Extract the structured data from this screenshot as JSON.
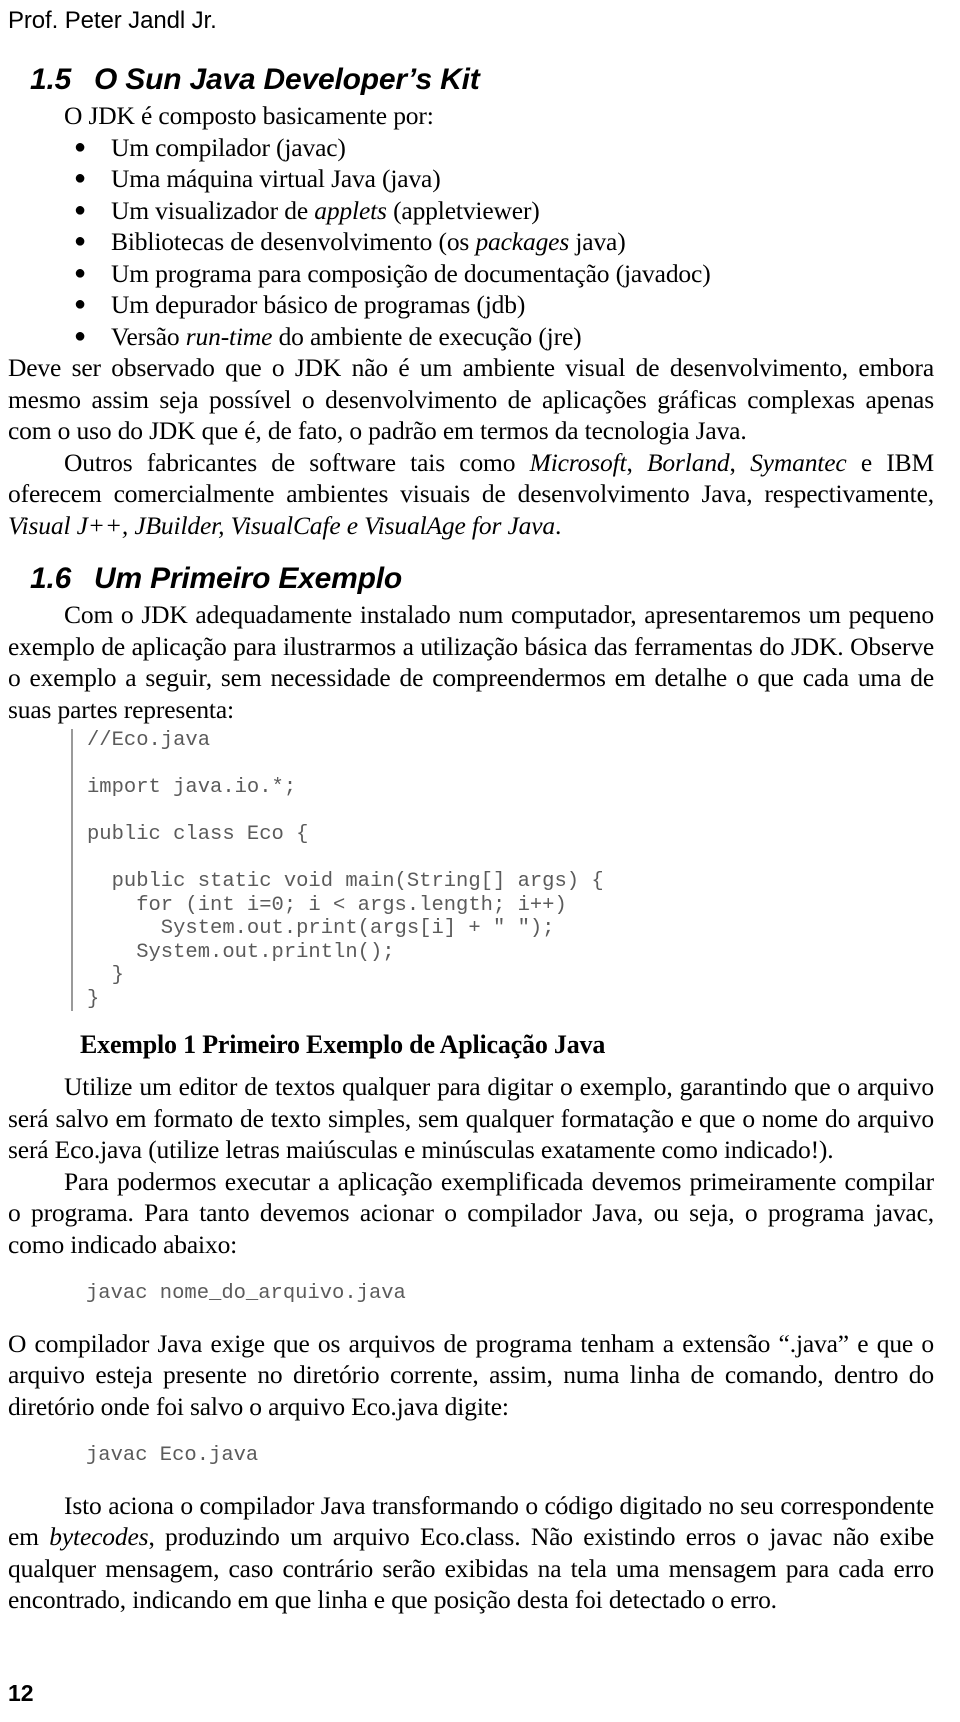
{
  "running_header": "Prof. Peter Jandl Jr.",
  "page_number": "12",
  "sections": {
    "s15": {
      "number": "1.5",
      "title": "O Sun Java Developer’s Kit",
      "lead": "O JDK é composto basicamente por:",
      "bullets": [
        {
          "text": "Um compilador (javac)"
        },
        {
          "text": "Uma máquina virtual Java (java)"
        },
        {
          "pre": "Um visualizador de ",
          "em": "applets",
          "post": " (appletviewer)"
        },
        {
          "pre": "Bibliotecas de desenvolvimento (os ",
          "em": "packages",
          "post": " java)"
        },
        {
          "text": "Um programa para composição de documentação (javadoc)"
        },
        {
          "text": "Um depurador básico de programas (jdb)"
        },
        {
          "pre": "Versão ",
          "em": "run-time",
          "post": " do ambiente de execução (jre)"
        }
      ],
      "para1": "Deve ser observado que o JDK não é um ambiente visual de desenvolvimento, embora mesmo assim seja possível o desenvolvimento de aplicações gráficas complexas apenas com o uso do JDK que é, de fato, o padrão em termos da tecnologia Java.",
      "para2": {
        "p1": "Outros fabricantes de software tais como ",
        "em1": "Microsoft",
        "p2": ", ",
        "em2": "Borland",
        "p3": ", ",
        "em3": "Symantec",
        "p4": " e IBM oferecem comercialmente ambientes visuais de desenvolvimento Java, respectivamente, ",
        "em4": "Visual J++, JBuilder, VisualCafe e VisualAge for Java",
        "p5": "."
      }
    },
    "s16": {
      "number": "1.6",
      "title": "Um Primeiro Exemplo",
      "para1": "Com o JDK adequadamente instalado num computador, apresentaremos um pequeno exemplo de aplicação para ilustrarmos a utilização básica das ferramentas do JDK. Observe o exemplo a seguir, sem necessidade de compreendermos em detalhe o que cada uma de suas partes representa:",
      "code_example": "//Eco.java\n\nimport java.io.*;\n\npublic class Eco {\n\n  public static void main(String[] args) {\n    for (int i=0; i < args.length; i++)\n      System.out.print(args[i] + \" \");\n    System.out.println();\n  }\n}",
      "caption": "Exemplo 1 Primeiro Exemplo de Aplicação Java",
      "para2": "Utilize um editor de textos qualquer para digitar o exemplo, garantindo que o arquivo será salvo em formato de texto simples, sem qualquer formatação e que o nome do arquivo será Eco.java (utilize letras maiúsculas e minúsculas exatamente como indicado!).",
      "para3": "Para podermos executar a aplicação exemplificada devemos primeiramente compilar o programa. Para tanto devemos acionar o compilador Java, ou seja, o programa javac, como indicado abaixo:",
      "code_cmd1": "javac nome_do_arquivo.java",
      "para4": "O compilador Java exige que os arquivos de programa tenham a extensão “.java” e que o arquivo esteja presente no diretório corrente, assim, numa linha de comando, dentro do diretório onde foi salvo o arquivo Eco.java digite:",
      "code_cmd2": "javac Eco.java",
      "para5": {
        "p1": "Isto aciona o compilador Java transformando o código digitado no seu correspondente em ",
        "em1": "bytecodes",
        "p2": ", produzindo um arquivo Eco.class. Não existindo erros o javac não exibe qualquer mensagem, caso contrário serão exibidas na tela uma mensagem para cada erro encontrado, indicando em que linha e que posição desta foi detectado o erro."
      }
    }
  }
}
